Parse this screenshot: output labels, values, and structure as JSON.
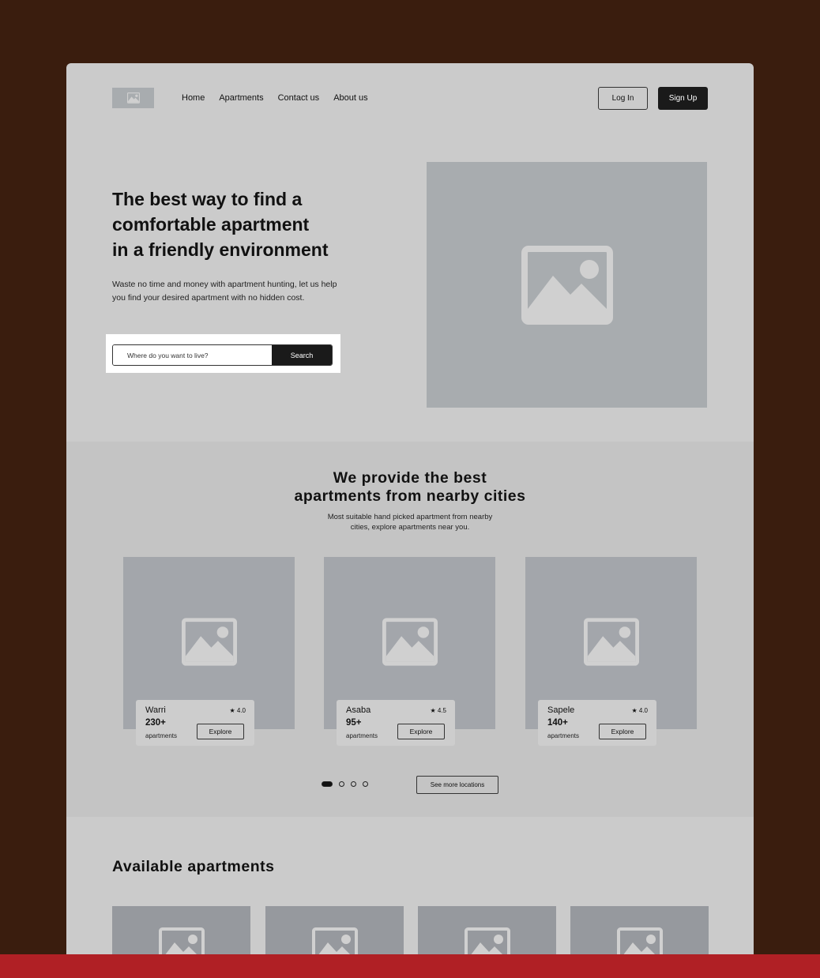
{
  "colors": {
    "outer_background": "#3a1d0e",
    "frame": "#cbcbcb",
    "section_alt": "#c4c4c4",
    "placeholder": "#a8acaf",
    "dark_button": "#1a1a1a",
    "footer_bar": "#b02025"
  },
  "header": {
    "logo_icon": "image-icon",
    "nav": [
      "Home",
      "Apartments",
      "Contact us",
      "About us"
    ],
    "login_label": "Log In",
    "signup_label": "Sign Up"
  },
  "hero": {
    "title_line1": "The best way to find a",
    "title_line2": "comfortable apartment",
    "title_line3_start": "in a",
    "title_line3_em": "friendly",
    "title_line3_end": "environment",
    "description": "Waste no time and money with apartment hunting, let us help you find your desired apartment with no hidden cost.",
    "search": {
      "placeholder": "Where do you want to live?",
      "button_label": "Search"
    },
    "image_icon": "image-icon"
  },
  "cities_section": {
    "title_line1": "We provide the best",
    "title_line2": "apartments from nearby cities",
    "subtitle_line1": "Most suitable hand picked apartment from nearby",
    "subtitle_line2": "cities, explore apartments near you.",
    "cities": [
      {
        "name": "Warri",
        "rating": "★ 4.0",
        "count": "230+",
        "unit": "apartments",
        "button": "Explore"
      },
      {
        "name": "Asaba",
        "rating": "★ 4.5",
        "count": "95+",
        "unit": "apartments",
        "button": "Explore"
      },
      {
        "name": "Sapele",
        "rating": "★ 4.0",
        "count": "140+",
        "unit": "apartments",
        "button": "Explore"
      }
    ],
    "carousel_pages": 4,
    "carousel_active": 1,
    "see_more_label": "See more locations"
  },
  "available": {
    "title": "Available apartments",
    "card_count": 4
  }
}
